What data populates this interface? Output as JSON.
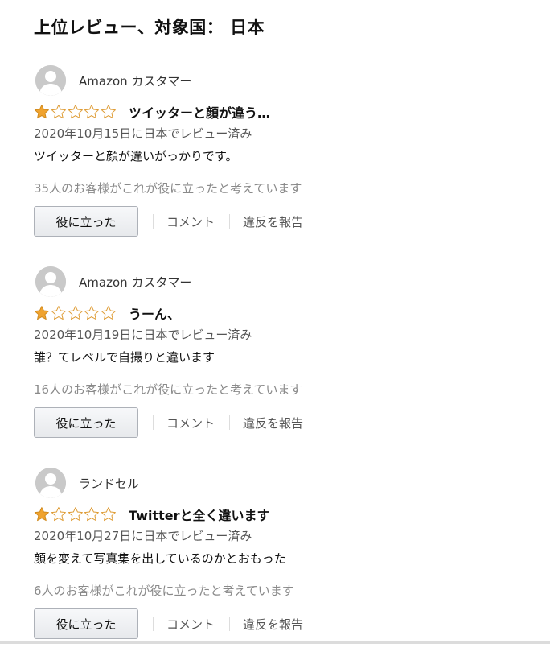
{
  "page": {
    "title": "上位レビュー、対象国： 日本"
  },
  "colors": {
    "star_filled": "#f0a32f",
    "star_empty_outline": "#de9a31",
    "avatar_bg": "#c9c9c9"
  },
  "reviews": [
    {
      "reviewer": "Amazon カスタマー",
      "rating": 1,
      "max_rating": 5,
      "title": "ツイッターと顔が違う…",
      "date": "2020年10月15日に日本でレビュー済み",
      "body": "ツイッターと顔が違いがっかりです。",
      "helpful": "35人のお客様がこれが役に立ったと考えています",
      "helpful_button": "役に立った",
      "comment_link": "コメント",
      "report_link": "違反を報告"
    },
    {
      "reviewer": "Amazon カスタマー",
      "rating": 1,
      "max_rating": 5,
      "title": "うーん、",
      "date": "2020年10月19日に日本でレビュー済み",
      "body": "誰？てレベルで自撮りと違います",
      "helpful": "16人のお客様がこれが役に立ったと考えています",
      "helpful_button": "役に立った",
      "comment_link": "コメント",
      "report_link": "違反を報告"
    },
    {
      "reviewer": "ランドセル",
      "rating": 1,
      "max_rating": 5,
      "title": "Twitterと全く違います",
      "date": "2020年10月27日に日本でレビュー済み",
      "body": "顔を変えて写真集を出しているのかとおもった",
      "helpful": "6人のお客様がこれが役に立ったと考えています",
      "helpful_button": "役に立った",
      "comment_link": "コメント",
      "report_link": "違反を報告"
    }
  ]
}
